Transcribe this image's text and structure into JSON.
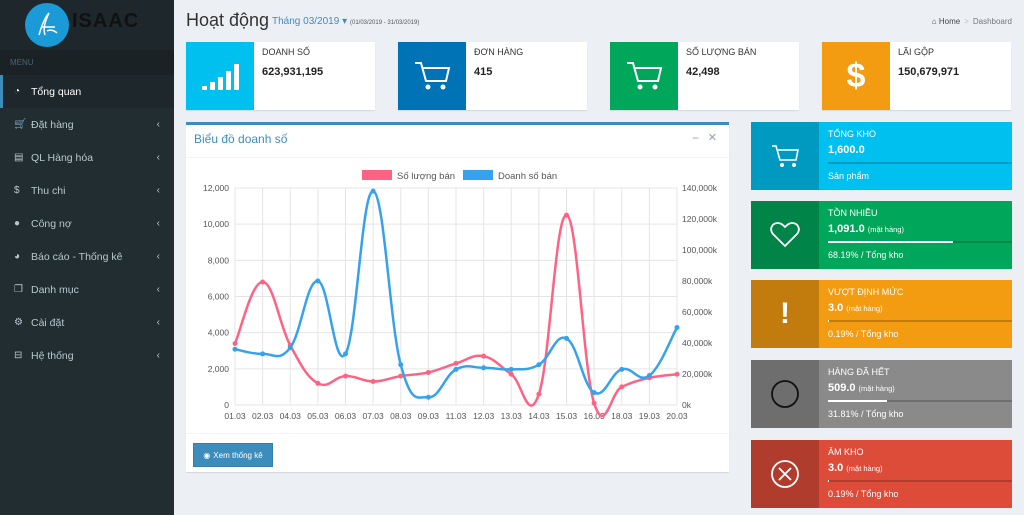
{
  "brand": {
    "name": "ISAAC"
  },
  "sidebar": {
    "header": "MENU",
    "items": [
      {
        "label": "Tổng quan",
        "icon": "dashboard-icon"
      },
      {
        "label": "Đặt hàng",
        "icon": "cart-icon"
      },
      {
        "label": "QL Hàng hóa",
        "icon": "list-icon"
      },
      {
        "label": "Thu chi",
        "icon": "dollar-icon"
      },
      {
        "label": "Công nợ",
        "icon": "user-icon"
      },
      {
        "label": "Báo cáo - Thống kê",
        "icon": "pie-chart-icon"
      },
      {
        "label": "Danh mục",
        "icon": "copy-icon"
      },
      {
        "label": "Cài đặt",
        "icon": "gear-icon"
      },
      {
        "label": "Hệ thống",
        "icon": "hdd-icon"
      }
    ]
  },
  "header": {
    "title": "Hoạt động",
    "period": "Tháng 03/2019",
    "range": "(01/03/2019 - 31/03/2019)",
    "breadcrumb": {
      "home": "Home",
      "current": "Dashboard"
    }
  },
  "kpis": [
    {
      "label": "DOANH SỐ",
      "value": "623,931,195",
      "color": "#00c0ef",
      "icon": "bar-chart-icon"
    },
    {
      "label": "ĐƠN HÀNG",
      "value": "415",
      "color": "#0073b7",
      "icon": "cart-icon"
    },
    {
      "label": "SỐ LƯỢNG BÁN",
      "value": "42,498",
      "color": "#00a65a",
      "icon": "cart-icon"
    },
    {
      "label": "LÃI GỘP",
      "value": "150,679,971",
      "color": "#f39c12",
      "icon": "dollar-icon"
    }
  ],
  "chart_box": {
    "title": "Biểu đồ doanh số",
    "button": "Xem thống kê"
  },
  "chart_data": {
    "type": "line",
    "categories": [
      "01.03",
      "02.03",
      "04.03",
      "05.03",
      "06.03",
      "07.03",
      "08.03",
      "09.03",
      "11.03",
      "12.03",
      "13.03",
      "14.03",
      "15.03",
      "16.03",
      "18.03",
      "19.03",
      "20.03"
    ],
    "series": [
      {
        "name": "Số lượng bán",
        "color": "#ff6384",
        "axis": "left",
        "values": [
          3400,
          6800,
          3300,
          1200,
          1600,
          1300,
          1600,
          1800,
          2300,
          2700,
          1700,
          600,
          10500,
          100,
          1000,
          1500,
          1700
        ]
      },
      {
        "name": "Doanh số bán",
        "color": "#36a2eb",
        "axis": "right",
        "values": [
          36000,
          33000,
          37000,
          80000,
          33000,
          138000,
          26000,
          5000,
          23000,
          24000,
          23000,
          26000,
          43000,
          8000,
          23000,
          19000,
          50000
        ]
      }
    ],
    "yleft": {
      "ticks": [
        "0",
        "2,000",
        "4,000",
        "6,000",
        "8,000",
        "10,000",
        "12,000"
      ],
      "max": 12000
    },
    "yright": {
      "ticks": [
        "0k",
        "20,000k",
        "40,000k",
        "60,000k",
        "80,000k",
        "100,000k",
        "120,000k",
        "140,000k"
      ],
      "max": 140000
    },
    "grid": true,
    "legend": "top"
  },
  "side_boxes": [
    {
      "label": "TỔNG KHO",
      "value": "1,600.0",
      "unit": "",
      "desc": "Sản phẩm",
      "color": "#00c0ef",
      "icon": "cart-icon",
      "progress": null
    },
    {
      "label": "TỒN NHIỀU",
      "value": "1,091.0",
      "unit": "(mặt hàng)",
      "desc": "68.19% / Tổng kho",
      "color": "#00a65a",
      "icon": "heart-icon",
      "progress": 0.6819
    },
    {
      "label": "VƯỢT ĐỊNH MỨC",
      "value": "3.0",
      "unit": "(mặt hàng)",
      "desc": "0.19% / Tổng kho",
      "color": "#f39c12",
      "icon": "exclamation-icon",
      "progress": 0.0019
    },
    {
      "label": "HÀNG ĐÃ HẾT",
      "value": "509.0",
      "unit": "(mặt hàng)",
      "desc": "31.81% / Tổng kho",
      "color": "#8a8a8a",
      "icon": "circle-icon",
      "progress": 0.3181
    },
    {
      "label": "ÂM KHO",
      "value": "3.0",
      "unit": "(mặt hàng)",
      "desc": "0.19% / Tổng kho",
      "color": "#dd4b39",
      "icon": "times-circle-icon",
      "progress": 0.0019
    }
  ]
}
